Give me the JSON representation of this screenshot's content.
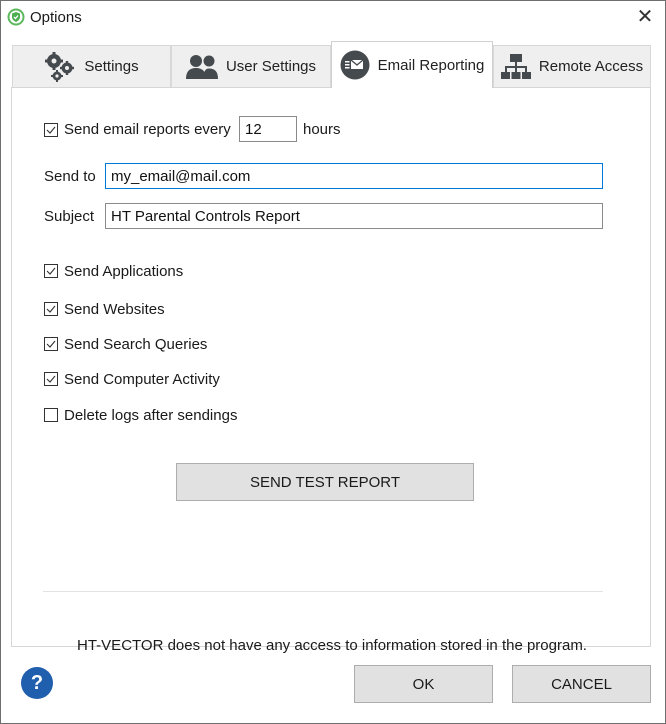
{
  "window": {
    "title": "Options",
    "close_label": "✕"
  },
  "tabs": [
    {
      "label": "Settings",
      "icon": "gears-icon",
      "active": false
    },
    {
      "label": "User Settings",
      "icon": "users-icon",
      "active": false
    },
    {
      "label": "Email Reporting",
      "icon": "email-icon",
      "active": true
    },
    {
      "label": "Remote Access",
      "icon": "network-icon",
      "active": false
    }
  ],
  "email": {
    "send_every": {
      "label": "Send email reports every",
      "checked": true,
      "value": "12",
      "unit": "hours"
    },
    "send_to": {
      "label": "Send to",
      "value": "my_email@mail.com"
    },
    "subject": {
      "label": "Subject",
      "value": "HT Parental Controls Report"
    },
    "options": [
      {
        "label": "Send Applications",
        "checked": true
      },
      {
        "label": "Send Websites",
        "checked": true
      },
      {
        "label": "Send Search Queries",
        "checked": true
      },
      {
        "label": "Send Computer Activity",
        "checked": true
      },
      {
        "label": "Delete logs after sendings",
        "checked": false
      }
    ],
    "test_button": "SEND TEST REPORT",
    "note": "HT-VECTOR does not have any access to information stored in the program."
  },
  "footer": {
    "help_label": "?",
    "ok_label": "OK",
    "cancel_label": "CANCEL"
  },
  "colors": {
    "accent": "#0078d7",
    "help": "#1f5fad",
    "app_icon": "#4caf50"
  }
}
